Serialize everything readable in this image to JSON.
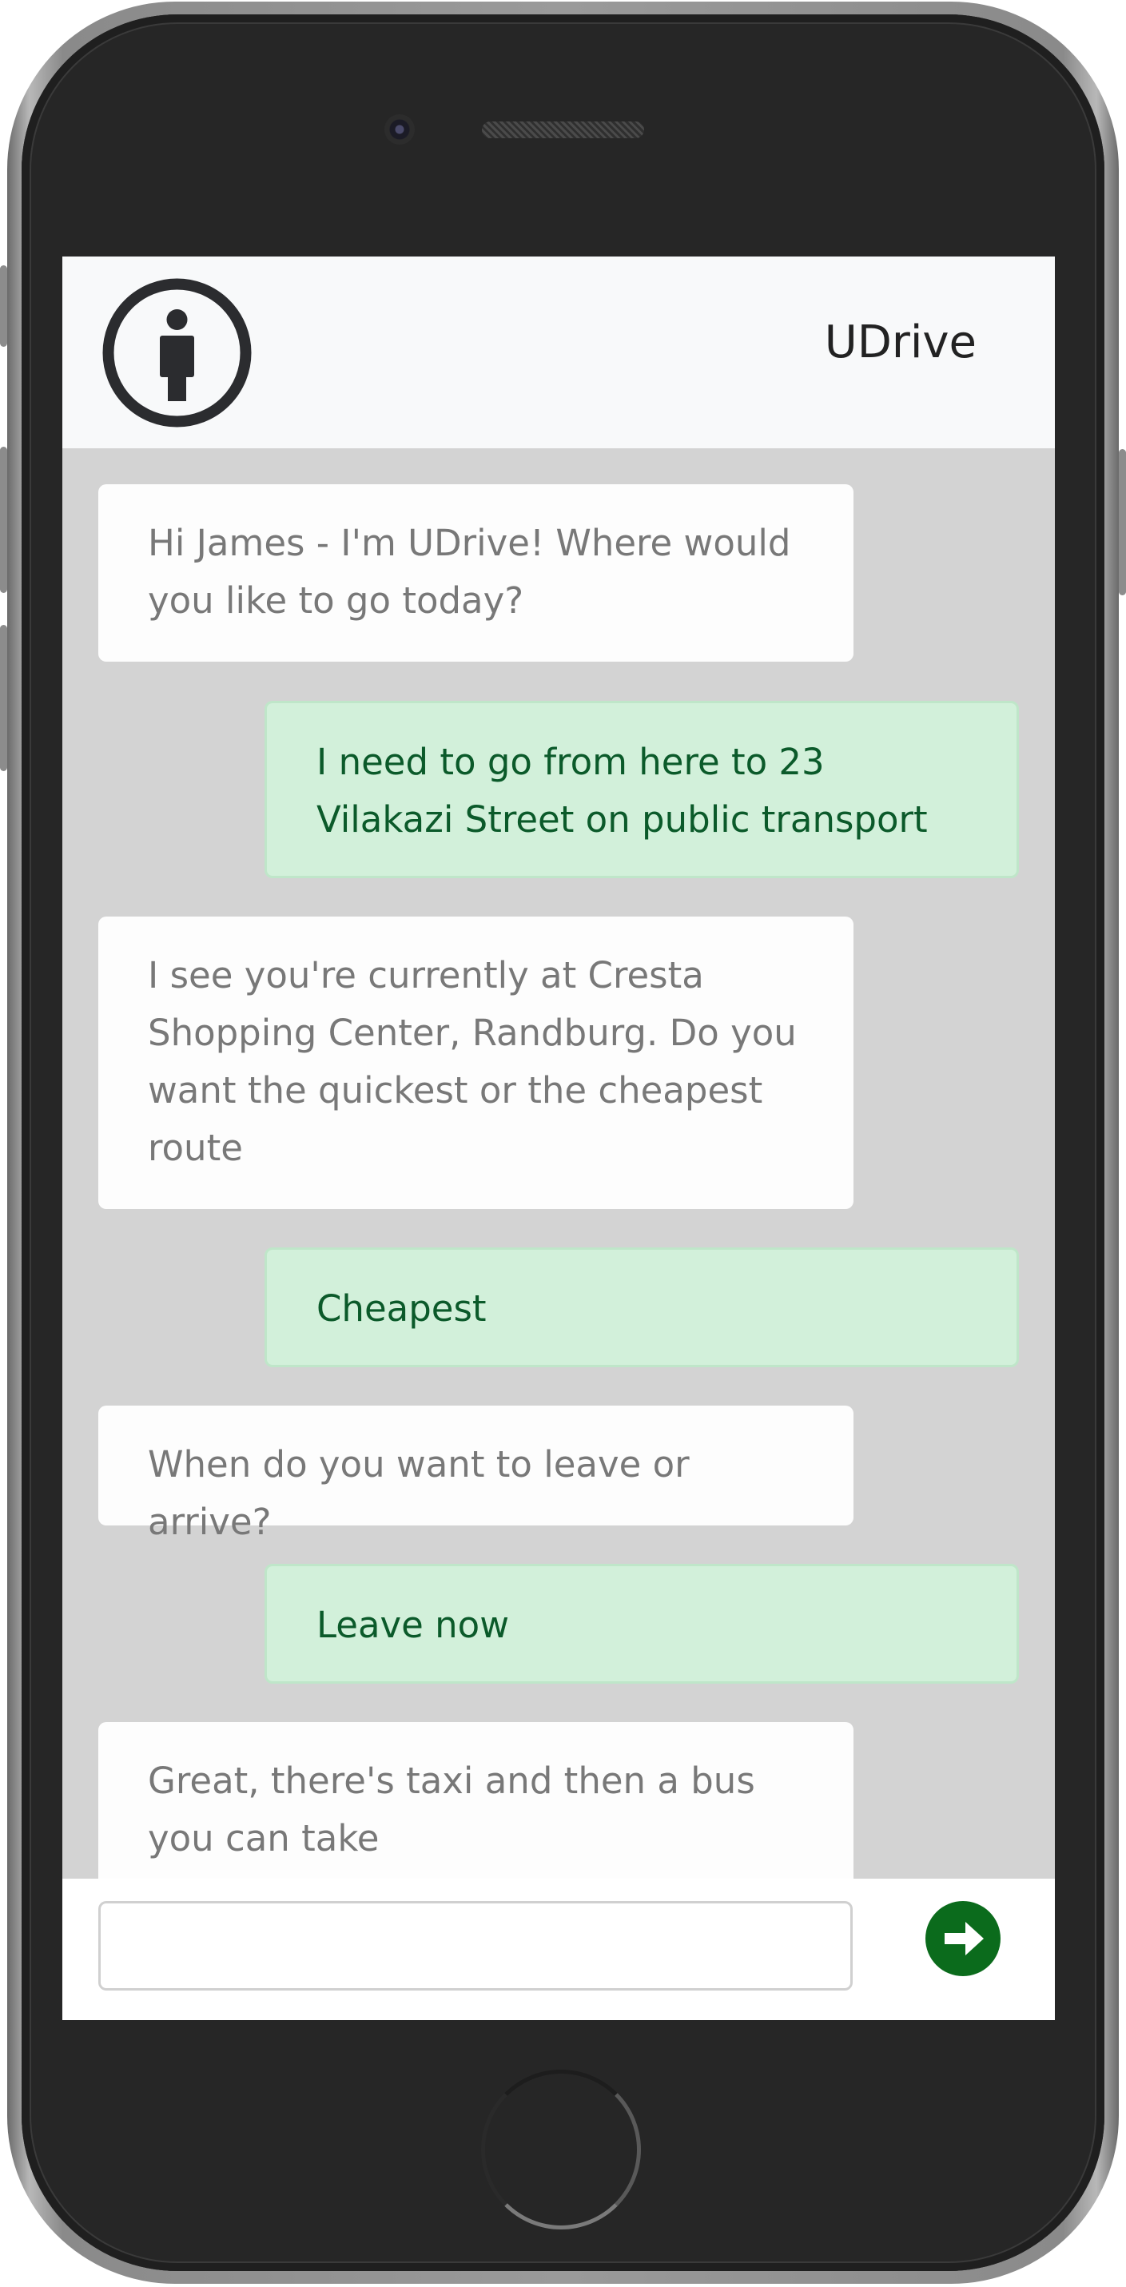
{
  "app": {
    "title": "UDrive"
  },
  "chat": {
    "messages": [
      {
        "from": "bot",
        "text": "Hi James - I'm UDrive! Where would you like to go today?"
      },
      {
        "from": "user",
        "text": "I need to go from here to 23 Vilakazi Street on public transport"
      },
      {
        "from": "bot",
        "text": "I see you're currently at Cresta Shopping Center, Randburg. Do you want the quickest or the cheapest route"
      },
      {
        "from": "user",
        "text": "Cheapest"
      },
      {
        "from": "bot",
        "text": "When do you want to leave or arrive?"
      },
      {
        "from": "user",
        "text": "Leave now"
      },
      {
        "from": "bot",
        "text": "Great, there's taxi and then a bus you can take"
      }
    ]
  },
  "composer": {
    "value": "",
    "placeholder": ""
  },
  "icons": {
    "logo": "person-info-icon",
    "send": "arrow-right-circle-icon"
  },
  "colors": {
    "send_button": "#0b6b1c",
    "user_bubble_bg": "#d2f0da",
    "user_bubble_text": "#0b5a2a",
    "bot_bubble_bg": "#fdfdfd",
    "bot_bubble_text": "#787878",
    "chat_bg": "#d3d3d3"
  }
}
